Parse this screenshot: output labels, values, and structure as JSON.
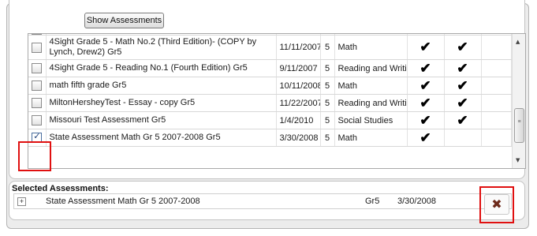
{
  "toolbar": {
    "show_assessments_label": "Show Assessments"
  },
  "assessments": {
    "rows": [
      {
        "checked": false,
        "name": "4Sight Grade 5 - Math No.2 (Third Edition)- (COPY by Lynch, Drew2) Gr5",
        "date": "11/11/2007",
        "grade": "5",
        "subject": "Math",
        "mark1": "✔",
        "mark2": "✔"
      },
      {
        "checked": false,
        "name": "4Sight Grade 5 - Reading No.1 (Fourth Edition) Gr5",
        "date": "9/11/2007",
        "grade": "5",
        "subject": "Reading and Writing",
        "mark1": "✔",
        "mark2": "✔"
      },
      {
        "checked": false,
        "name": "math fifth grade Gr5",
        "date": "10/11/2008",
        "grade": "5",
        "subject": "Math",
        "mark1": "✔",
        "mark2": "✔"
      },
      {
        "checked": false,
        "name": "MiltonHersheyTest - Essay - copy Gr5",
        "date": "11/22/2007",
        "grade": "5",
        "subject": "Reading and Writing",
        "mark1": "✔",
        "mark2": "✔"
      },
      {
        "checked": false,
        "name": "Missouri Test Assessment Gr5",
        "date": "1/4/2010",
        "grade": "5",
        "subject": "Social Studies",
        "mark1": "✔",
        "mark2": "✔"
      },
      {
        "checked": true,
        "name": "State Assessment Math Gr 5 2007-2008 Gr5",
        "date": "3/30/2008",
        "grade": "5",
        "subject": "Math",
        "mark1": "✔",
        "mark2": ""
      }
    ]
  },
  "selected": {
    "title": "Selected Assessments:",
    "expander": "+",
    "row": {
      "name": "State Assessment Math Gr 5 2007-2008",
      "grade": "Gr5",
      "date": "3/30/2008"
    },
    "remove_icon": "✖"
  },
  "icons": {
    "scroll_up": "▲",
    "scroll_down": "▼",
    "grip": "≡"
  },
  "colors": {
    "highlight": "#e01010"
  }
}
